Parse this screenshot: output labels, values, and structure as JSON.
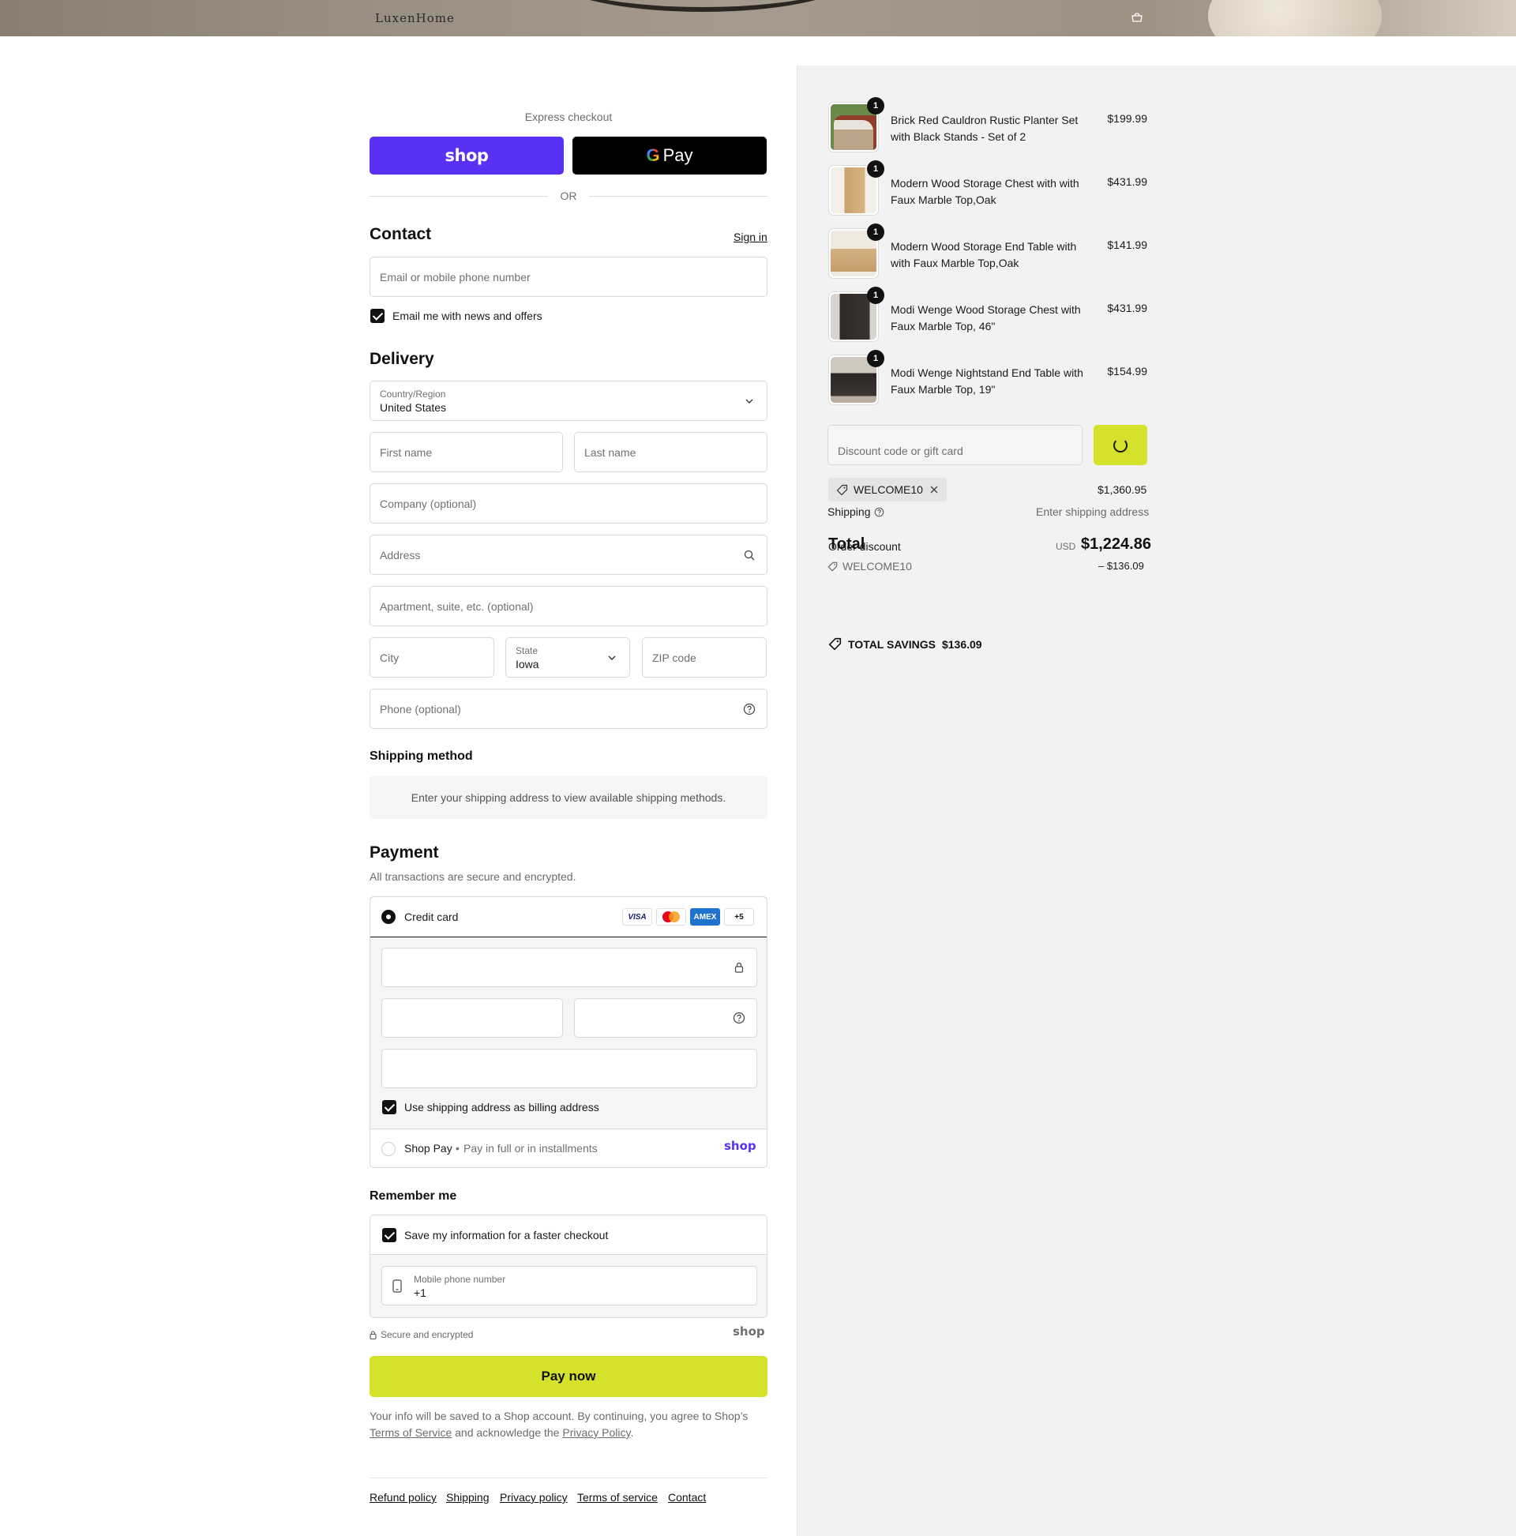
{
  "header": {
    "logo": "LuxenHome"
  },
  "express": {
    "label": "Express checkout",
    "shop_label": "shop",
    "gpay_g": "G",
    "gpay_label": "Pay",
    "or": "OR"
  },
  "contact": {
    "title": "Contact",
    "sign_in": "Sign in",
    "email_placeholder": "Email or mobile phone number",
    "news_label": "Email me with news and offers"
  },
  "delivery": {
    "title": "Delivery",
    "country_label": "Country/Region",
    "country_value": "United States",
    "first_name": "First name",
    "last_name": "Last name",
    "company": "Company (optional)",
    "address": "Address",
    "apartment": "Apartment, suite, etc. (optional)",
    "city": "City",
    "state_label": "State",
    "state_value": "Iowa",
    "zip": "ZIP code",
    "phone": "Phone (optional)"
  },
  "shipping": {
    "title": "Shipping method",
    "message": "Enter your shipping address to view available shipping methods."
  },
  "payment": {
    "title": "Payment",
    "subtitle": "All transactions are secure and encrypted.",
    "credit_card": "Credit card",
    "cards": [
      "VISA",
      "",
      "AMEX",
      "+5"
    ],
    "billing_label": "Use shipping address as billing address",
    "shop_pay": "Shop Pay",
    "shop_pay_sub": "Pay in full or in installments",
    "shop_pay_logo": "shop"
  },
  "remember": {
    "title": "Remember me",
    "save_label": "Save my information for a faster checkout",
    "phone_label": "Mobile phone number",
    "phone_value": "+1"
  },
  "secure": {
    "label": "Secure and encrypted",
    "logo": "shop"
  },
  "pay_now": "Pay now",
  "legal": {
    "text1": "Your info will be saved to a Shop account. By continuing, you agree to Shop’s",
    "tos": "Terms of Service",
    "text2": "and acknowledge the",
    "privacy": "Privacy Policy",
    "text3": "."
  },
  "footer": [
    "Refund policy",
    "Shipping",
    "Privacy policy",
    "Terms of service",
    "Contact"
  ],
  "order": {
    "items": [
      {
        "qty": "1",
        "name": "Brick Red Cauldron Rustic Planter Set with Black Stands - Set of 2",
        "price": "$199.99"
      },
      {
        "qty": "1",
        "name": "Modern Wood Storage Chest with with Faux Marble Top,Oak",
        "price": "$431.99"
      },
      {
        "qty": "1",
        "name": "Modern Wood Storage End Table with with Faux Marble Top,Oak",
        "price": "$141.99"
      },
      {
        "qty": "1",
        "name": "Modi Wenge Wood Storage Chest with Faux Marble Top, 46\"",
        "price": "$431.99"
      },
      {
        "qty": "1",
        "name": "Modi Wenge Nightstand End Table with Faux Marble Top, 19\"",
        "price": "$154.99"
      }
    ],
    "discount_placeholder": "Discount code or gift card",
    "code": "WELCOME10",
    "subtotal": "$1,360.95",
    "shipping_label": "Shipping",
    "shipping_value": "Enter shipping address",
    "total_label": "Total",
    "order_discount_label": "Order discount",
    "currency": "USD",
    "total": "$1,224.86",
    "discount_code": "WELCOME10",
    "discount_amount": "– $136.09",
    "savings_label": "TOTAL SAVINGS",
    "savings_amount": "$136.09"
  },
  "colors": {
    "shop_purple": "#5a31f4",
    "accent_lime": "#d4e22c"
  }
}
